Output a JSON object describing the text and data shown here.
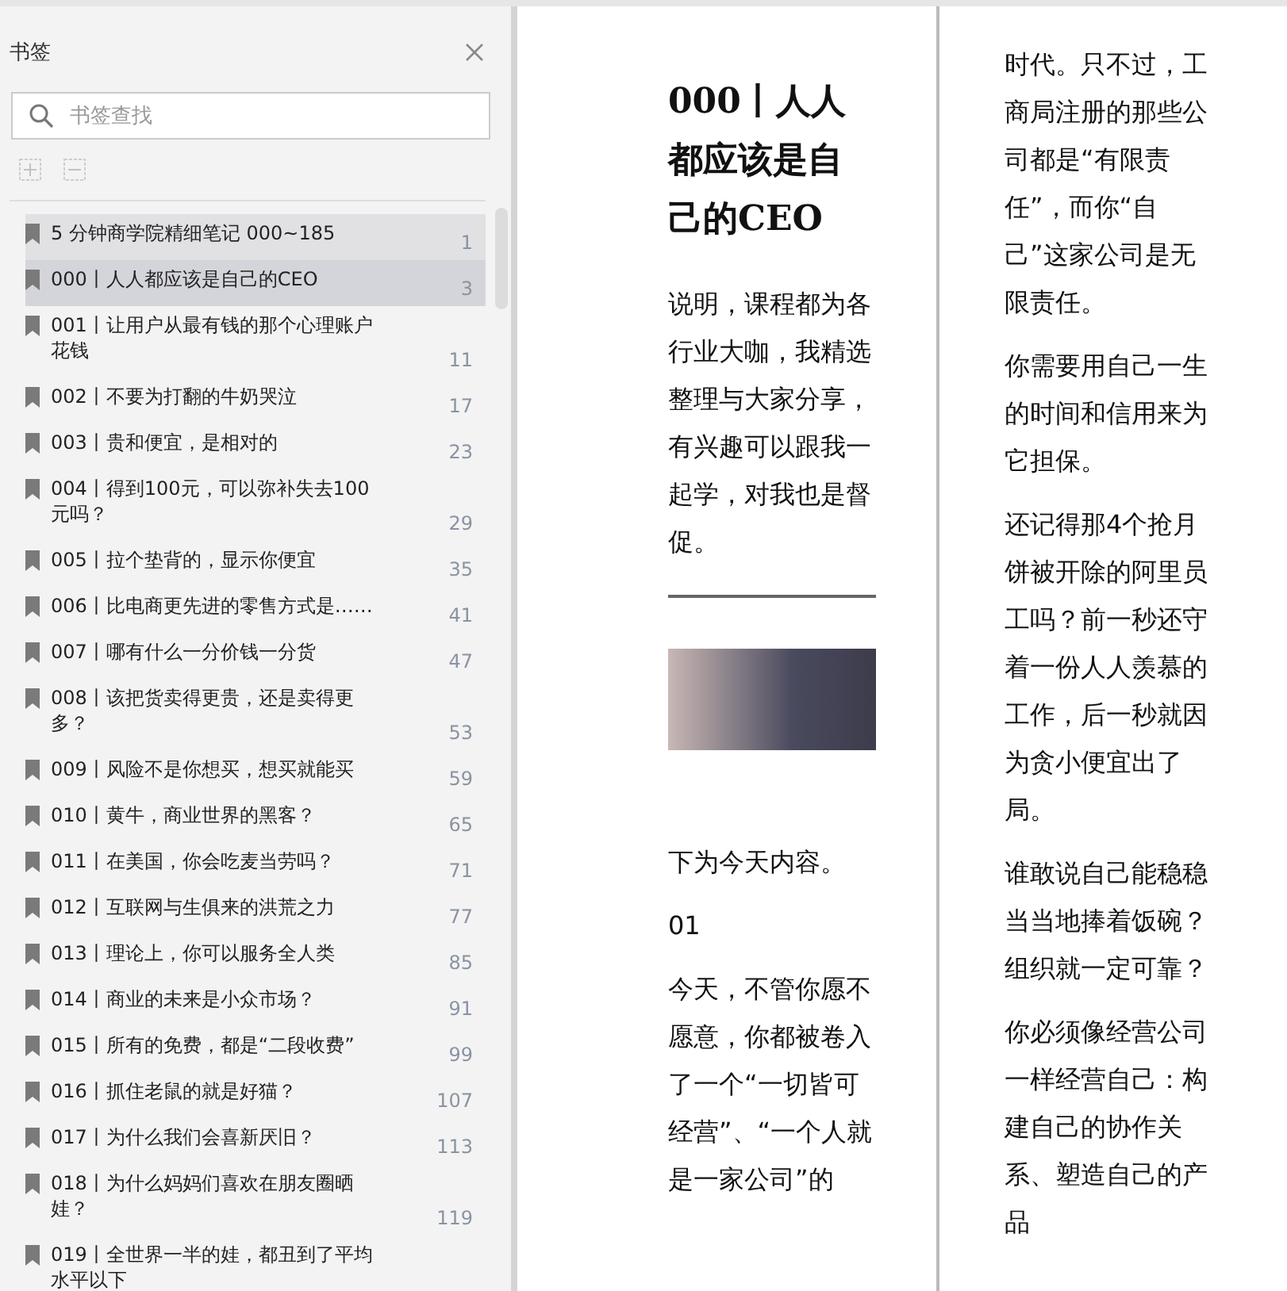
{
  "sidebar": {
    "title": "书签",
    "search": {
      "placeholder": "书签查找"
    },
    "toolbar_buttons": [
      {
        "kind": "add",
        "disabled": true
      },
      {
        "kind": "remove",
        "disabled": true
      }
    ],
    "bookmarks": [
      {
        "title": "5 分钟商学院精细笔记 000~185",
        "page": "1",
        "selected": false,
        "hovered": true
      },
      {
        "title": "000丨人人都应该是自己的CEO",
        "page": "3",
        "selected": true,
        "hovered": false
      },
      {
        "title": "001丨让用户从最有钱的那个心理账户花钱",
        "page": "11",
        "selected": false,
        "hovered": false
      },
      {
        "title": "002丨不要为打翻的牛奶哭泣",
        "page": "17",
        "selected": false,
        "hovered": false
      },
      {
        "title": "003丨贵和便宜，是相对的",
        "page": "23",
        "selected": false,
        "hovered": false
      },
      {
        "title": "004丨得到100元，可以弥补失去100元吗？",
        "page": "29",
        "selected": false,
        "hovered": false
      },
      {
        "title": "005丨拉个垫背的，显示你便宜",
        "page": "35",
        "selected": false,
        "hovered": false
      },
      {
        "title": "006丨比电商更先进的零售方式是……",
        "page": "41",
        "selected": false,
        "hovered": false
      },
      {
        "title": "007丨哪有什么一分价钱一分货",
        "page": "47",
        "selected": false,
        "hovered": false
      },
      {
        "title": "008丨该把货卖得更贵，还是卖得更多？",
        "page": "53",
        "selected": false,
        "hovered": false
      },
      {
        "title": "009丨风险不是你想买，想买就能买",
        "page": "59",
        "selected": false,
        "hovered": false
      },
      {
        "title": "010丨黄牛，商业世界的黑客？",
        "page": "65",
        "selected": false,
        "hovered": false
      },
      {
        "title": "011丨在美国，你会吃麦当劳吗？",
        "page": "71",
        "selected": false,
        "hovered": false
      },
      {
        "title": "012丨互联网与生俱来的洪荒之力",
        "page": "77",
        "selected": false,
        "hovered": false
      },
      {
        "title": "013丨理论上，你可以服务全人类",
        "page": "85",
        "selected": false,
        "hovered": false
      },
      {
        "title": "014丨商业的未来是小众市场？",
        "page": "91",
        "selected": false,
        "hovered": false
      },
      {
        "title": "015丨所有的免费，都是“二段收费”",
        "page": "99",
        "selected": false,
        "hovered": false
      },
      {
        "title": "016丨抓住老鼠的就是好猫？",
        "page": "107",
        "selected": false,
        "hovered": false
      },
      {
        "title": "017丨为什么我们会喜新厌旧？",
        "page": "113",
        "selected": false,
        "hovered": false
      },
      {
        "title": "018丨为什么妈妈们喜欢在朋友圈晒娃？",
        "page": "119",
        "selected": false,
        "hovered": false
      },
      {
        "title": "019丨全世界一半的娃，都丑到了平均水平以下",
        "selected": false,
        "hovered": false
      }
    ]
  },
  "page": {
    "columns": [
      {
        "blocks": [
          {
            "kind": "heading",
            "text": "000丨人人都应该是自己的CEO"
          },
          {
            "kind": "paragraph",
            "text": "说明，课程都为各行业大咖，我精选整理与大家分享，有兴趣可以跟我一起学，对我也是督促。"
          },
          {
            "kind": "rule"
          },
          {
            "kind": "image"
          },
          {
            "kind": "paragraph",
            "text": "下为今天内容。"
          },
          {
            "kind": "paragraph",
            "text": "01"
          },
          {
            "kind": "paragraph",
            "text": "今天，不管你愿不愿意，你都被卷入了一个“一切皆可经营”、“一个人就是一家公司”的"
          }
        ]
      },
      {
        "blocks": [
          {
            "kind": "paragraph",
            "text": "时代。只不过，工商局注册的那些公司都是“有限责任”，而你“自己”这家公司是无限责任。"
          },
          {
            "kind": "paragraph",
            "text": "你需要用自己一生的时间和信用来为它担保。"
          },
          {
            "kind": "paragraph",
            "text": "还记得那4个抢月饼被开除的阿里员工吗？前一秒还守着一份人人羡慕的工作，后一秒就因为贪小便宜出了局。"
          },
          {
            "kind": "paragraph",
            "text": "谁敢说自己能稳稳当当地捧着饭碗？组织就一定可靠？"
          },
          {
            "kind": "paragraph",
            "text": "你必须像经营公司一样经营自己：构建自己的协作关系、塑造自己的产品"
          }
        ]
      }
    ]
  }
}
